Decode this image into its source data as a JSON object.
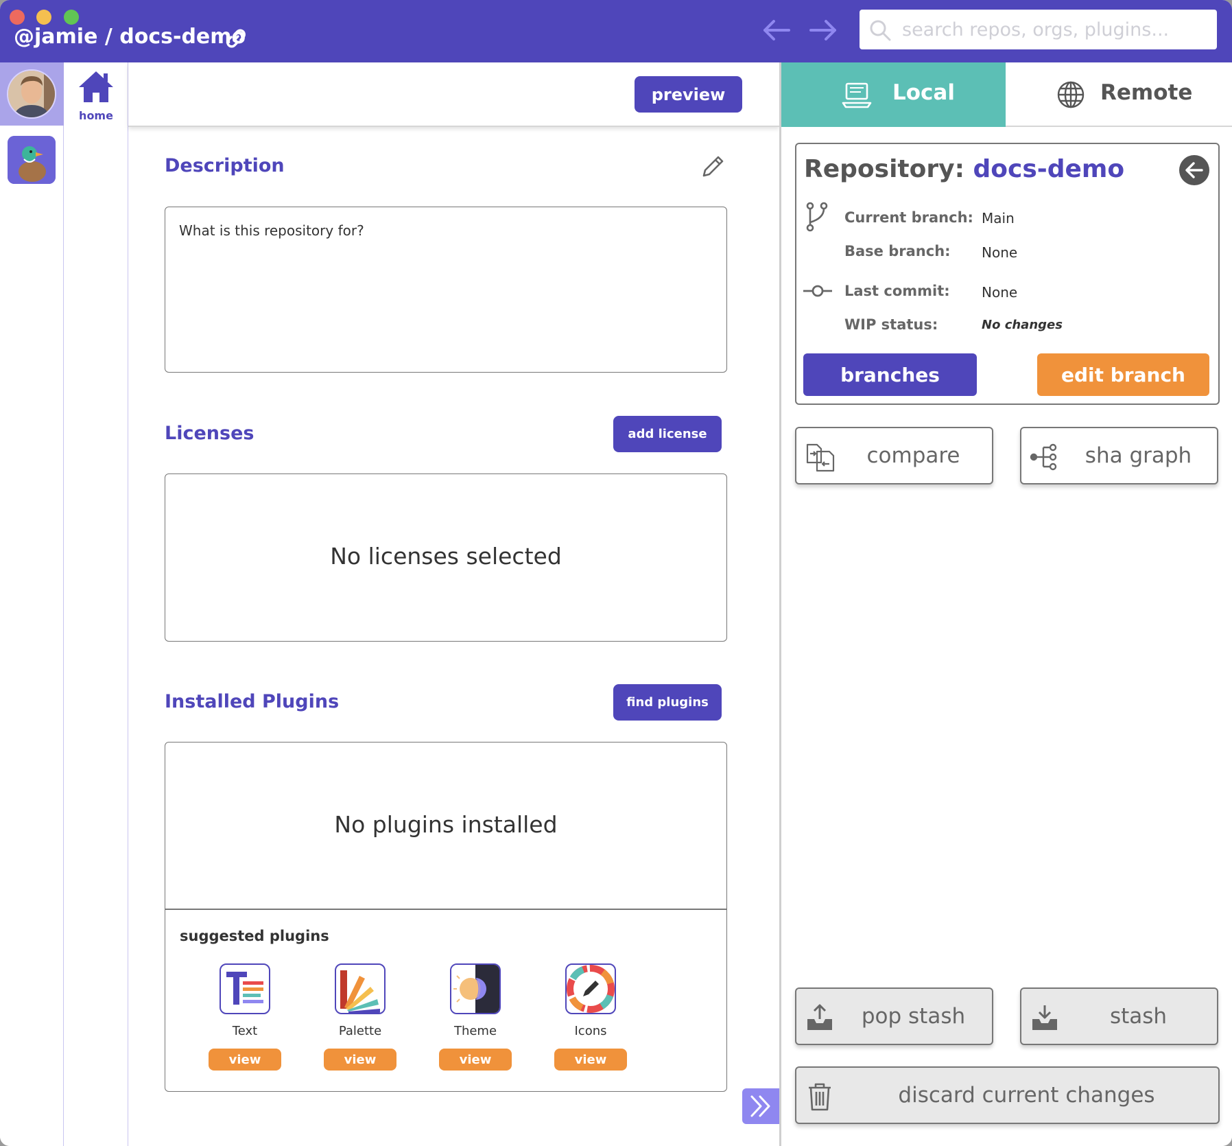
{
  "titlebar": {
    "path": "@jamie / docs-demo",
    "search_placeholder": "search repos, orgs, plugins..."
  },
  "rail": {
    "home_label": "home"
  },
  "main": {
    "preview_label": "preview",
    "description": {
      "title": "Description",
      "text": "What is this repository for?"
    },
    "licenses": {
      "title": "Licenses",
      "button": "add license",
      "empty": "No licenses selected"
    },
    "plugins": {
      "title": "Installed Plugins",
      "button": "find plugins",
      "empty": "No plugins installed",
      "suggested_label": "suggested plugins",
      "suggested": [
        {
          "name": "Text",
          "icon": "text-plugin-icon",
          "action": "view"
        },
        {
          "name": "Palette",
          "icon": "palette-plugin-icon",
          "action": "view"
        },
        {
          "name": "Theme",
          "icon": "theme-plugin-icon",
          "action": "view"
        },
        {
          "name": "Icons",
          "icon": "icons-plugin-icon",
          "action": "view"
        }
      ]
    }
  },
  "right": {
    "tabs": [
      {
        "label": "Local",
        "icon": "laptop-icon",
        "active": true
      },
      {
        "label": "Remote",
        "icon": "globe-icon",
        "active": false
      }
    ],
    "repo": {
      "label": "Repository:",
      "name": "docs-demo",
      "current_branch_label": "Current branch:",
      "current_branch": "Main",
      "base_branch_label": "Base branch:",
      "base_branch": "None",
      "last_commit_label": "Last commit:",
      "last_commit": "None",
      "wip_label": "WIP status:",
      "wip": "No changes",
      "branches_button": "branches",
      "edit_branch_button": "edit branch"
    },
    "actions": {
      "compare": "compare",
      "sha_graph": "sha graph",
      "pop_stash": "pop stash",
      "stash": "stash",
      "discard": "discard current changes"
    }
  },
  "colors": {
    "brand": "#4f46ba",
    "accent_orange": "#f0923b",
    "local_tab": "#5cbfb5"
  }
}
